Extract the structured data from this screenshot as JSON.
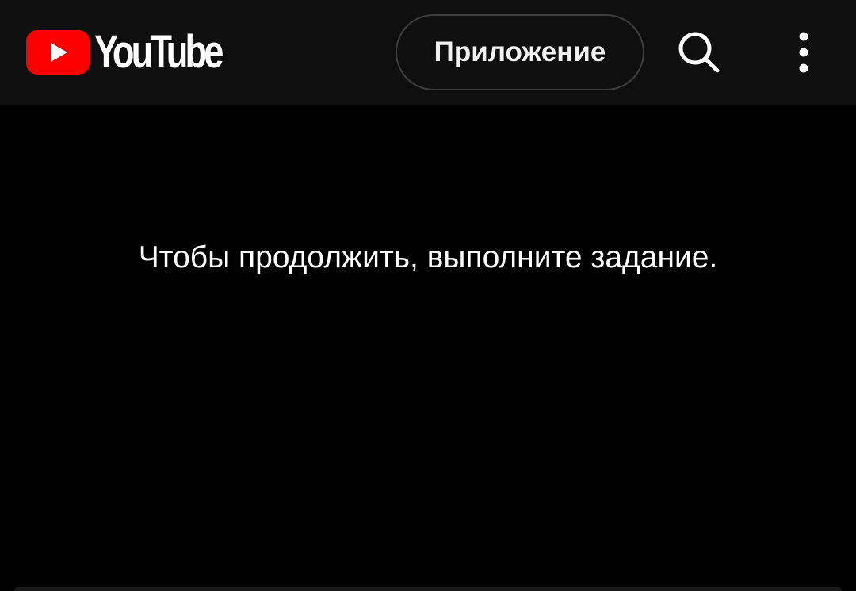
{
  "header": {
    "logo_text": "YouTube",
    "app_button_label": "Приложение",
    "icons": {
      "logo": "youtube-logo-icon",
      "search": "search-icon",
      "more": "more-vertical-icon"
    }
  },
  "main": {
    "message": "Чтобы продолжить, выполните задание."
  },
  "colors": {
    "brand_red": "#ff0000",
    "header_background": "#0f0f0f",
    "page_background": "#000000",
    "text": "#ffffff",
    "button_border": "#3f3f3f"
  }
}
